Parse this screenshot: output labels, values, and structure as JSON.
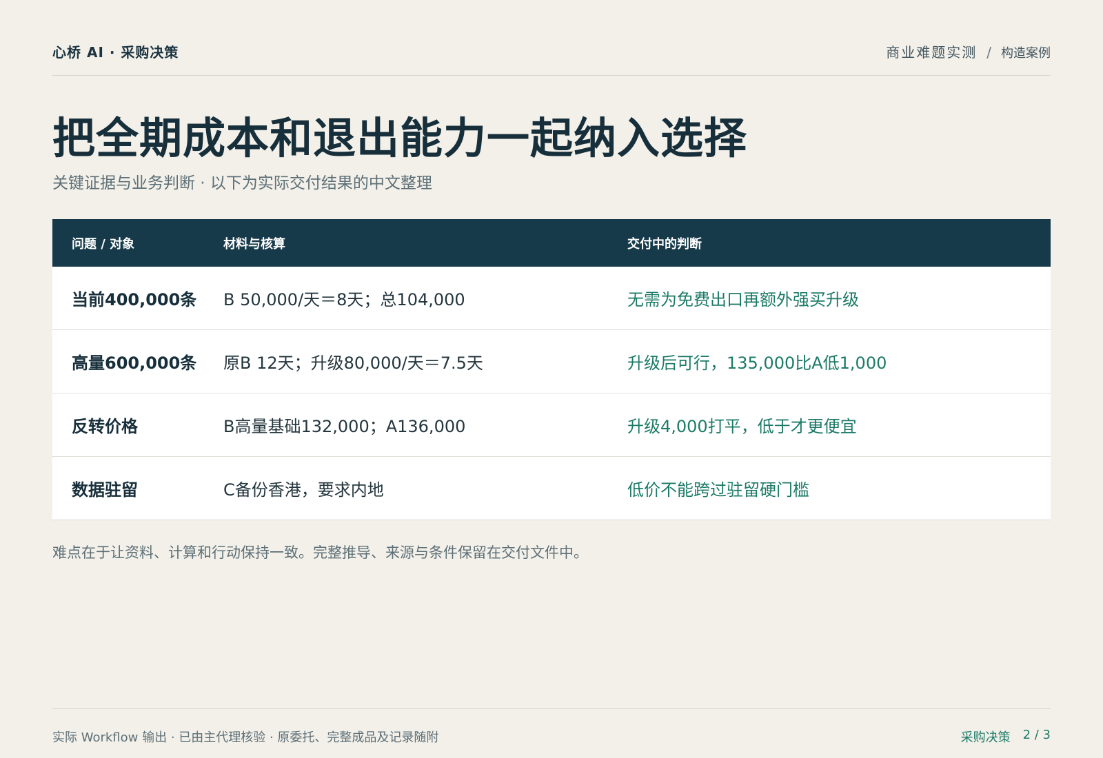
{
  "header": {
    "brand": "心桥 AI · 采购决策",
    "nav_primary": "商业难题实测",
    "nav_separator": "/",
    "nav_secondary": "构造案例"
  },
  "title": "把全期成本和退出能力一起纳入选择",
  "subtitle": "关键证据与业务判断 · 以下为实际交付结果的中文整理",
  "table": {
    "headers": [
      "问题 / 对象",
      "材料与核算",
      "交付中的判断"
    ],
    "rows": [
      [
        "当前400,000条",
        "B 50,000/天＝8天；总104,000",
        "无需为免费出口再额外强买升级"
      ],
      [
        "高量600,000条",
        "原B 12天；升级80,000/天＝7.5天",
        "升级后可行，135,000比A低1,000"
      ],
      [
        "反转价格",
        "B高量基础132,000；A136,000",
        "升级4,000打平，低于才更便宜"
      ],
      [
        "数据驻留",
        "C备份香港，要求内地",
        "低价不能跨过驻留硬门槛"
      ]
    ]
  },
  "note": "难点在于让资料、计算和行动保持一致。完整推导、来源与条件保留在交付文件中。",
  "footer": {
    "left": "实际 Workflow 输出 · 已由主代理核验 · 原委托、完整成品及记录随附",
    "section": "采购决策",
    "page": "2 / 3"
  },
  "colors": {
    "background": "#f3f0ea",
    "header_bar": "#173a4a",
    "accent_green": "#1c7a67",
    "title": "#172f3b"
  }
}
